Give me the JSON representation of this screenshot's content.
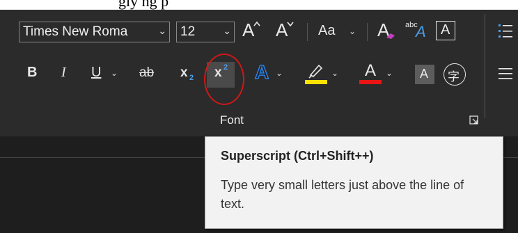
{
  "caption_text": "gly         ng     p",
  "font_group": {
    "font_name": "Times New Roma",
    "font_size": "12",
    "grow_font": "A",
    "shrink_font": "A",
    "change_case": "Aa",
    "clear_format": "A",
    "phonetic_guide_abc": "abc",
    "phonetic_guide_a": "A",
    "char_border": "A",
    "bold": "B",
    "italic": "I",
    "underline": "U",
    "strikethrough": "ab",
    "subscript_x": "x",
    "subscript_n": "2",
    "superscript_x": "x",
    "superscript_n": "2",
    "text_effects": "A",
    "font_color": "A",
    "char_shading": "A",
    "enclose_char": "字",
    "group_label": "Font"
  },
  "colors": {
    "highlight": "#ffe000",
    "font_color": "#e81515",
    "effects_blue": "#2a7fe0",
    "circle": "#d01818"
  },
  "tooltip": {
    "title": "Superscript (Ctrl+Shift++)",
    "description": "Type very small letters just above the line of text."
  }
}
